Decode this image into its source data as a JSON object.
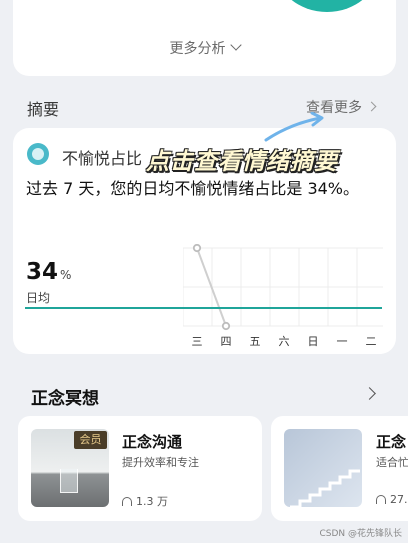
{
  "top_card": {
    "more_analysis": "更多分析"
  },
  "summary": {
    "title": "摘要",
    "view_more": "查看更多",
    "card_label": "不愉悦占比",
    "annotation": "点击查看情绪摘要",
    "description": "过去 7 天，您的日均不愉悦情绪占比是 34%。",
    "value": "34",
    "unit": "%",
    "value_label": "日均",
    "colors": {
      "accent": "#1fa59a",
      "annotation_text": "#fff8d2",
      "arrow": "#6fb3ea"
    }
  },
  "chart_data": {
    "type": "line",
    "categories": [
      "三",
      "四",
      "五",
      "六",
      "日",
      "一",
      "二"
    ],
    "values": [
      100,
      0,
      null,
      null,
      null,
      null,
      null
    ],
    "ylim": [
      0,
      100
    ],
    "grid": true
  },
  "meditation": {
    "title": "正念冥想",
    "courses": [
      {
        "name": "正念沟通",
        "desc": "提升效率和专注",
        "plays": "1.3 万",
        "badge": "会员"
      },
      {
        "name": "正念",
        "desc": "适合忙",
        "plays": "27.4"
      }
    ]
  },
  "watermark": "CSDN @花先锋队长"
}
